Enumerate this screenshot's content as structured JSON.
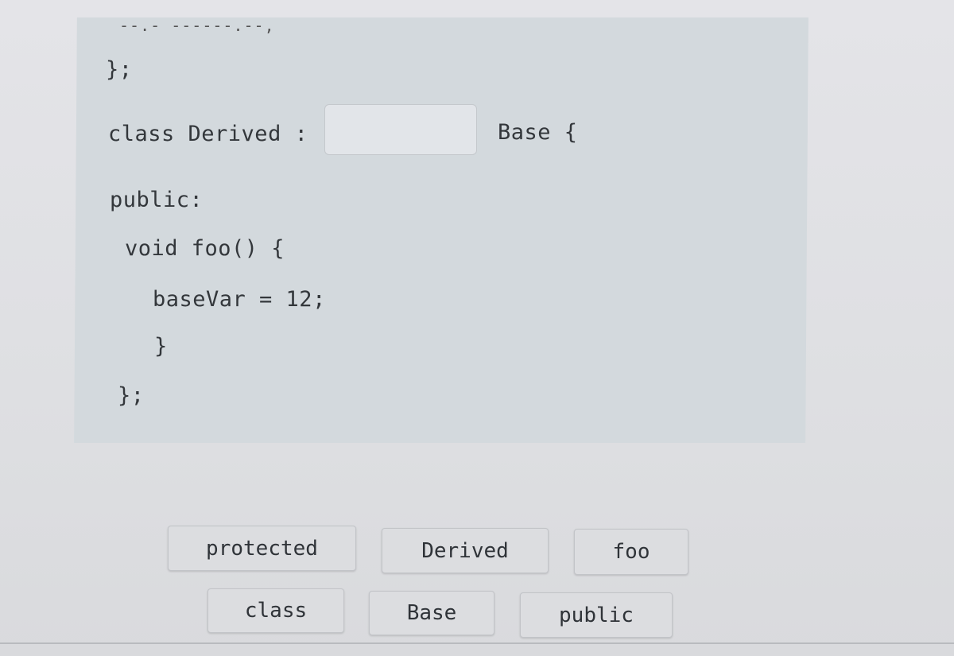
{
  "code": {
    "cut_line": "--.- ------.--,",
    "lines": [
      "};",
      "class Derived :",
      "Base {",
      "public:",
      "void foo() {",
      "baseVar = 12;",
      "}",
      "};"
    ]
  },
  "drop_slot": {
    "value": ""
  },
  "word_bank": [
    {
      "label": "protected"
    },
    {
      "label": "Derived"
    },
    {
      "label": "foo"
    },
    {
      "label": "class"
    },
    {
      "label": "Base"
    },
    {
      "label": "public"
    }
  ],
  "colors": {
    "panel": "#d3d9dd",
    "background": "#e0e1e4",
    "tile": "#dcdde0",
    "text": "#2e3236"
  }
}
